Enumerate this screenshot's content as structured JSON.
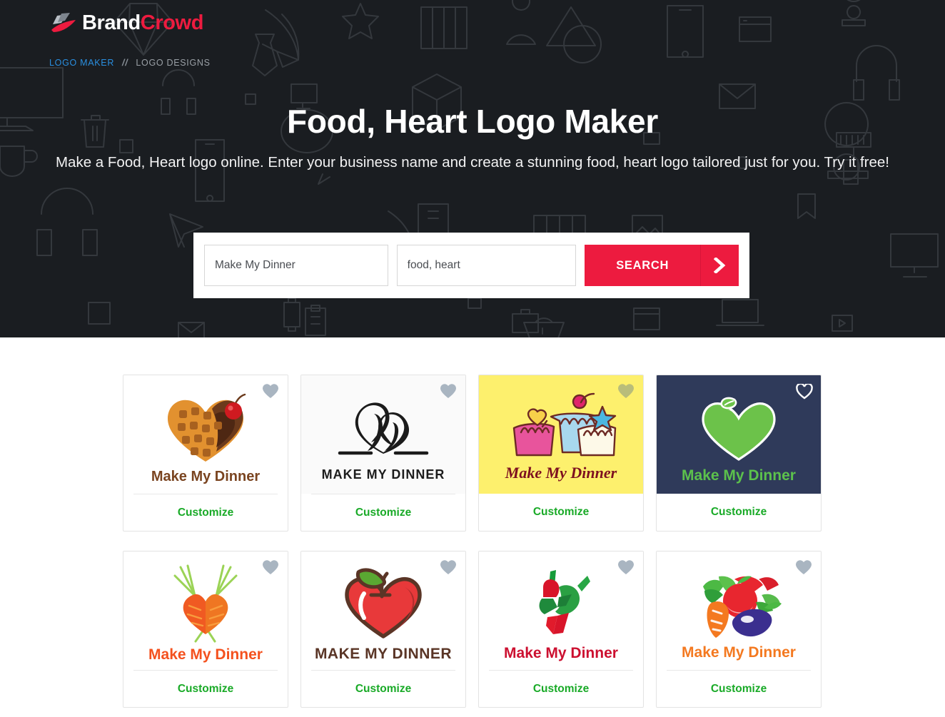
{
  "brand": {
    "name_part1": "Brand",
    "name_part2": "Crowd",
    "mark_icon": "swoosh-logo-icon"
  },
  "breadcrumb": {
    "home_label": "LOGO MAKER",
    "separator": "//",
    "current_label": "LOGO DESIGNS"
  },
  "hero": {
    "title": "Food, Heart Logo Maker",
    "subtitle": "Make a Food, Heart logo online. Enter your business name and create a stunning food, heart logo tailored just for you. Try it free!",
    "background_color": "#1a1d21",
    "background_pattern": "outline-doodle-icons"
  },
  "search": {
    "business_name_value": "Make My Dinner",
    "business_name_placeholder": "Make My Dinner",
    "keywords_value": "food, heart",
    "keywords_placeholder": "food, heart",
    "button_label": "SEARCH",
    "button_color": "#ED1B3F",
    "arrow_icon": "chevron-right-icon"
  },
  "results": {
    "customize_label": "Customize",
    "customize_color": "#19aa27",
    "favorite_icon": "heart-icon",
    "cards": [
      {
        "id": "waffle-heart",
        "logo_text": "Make My Dinner",
        "art_name": "heart-waffle-with-cherry-icon",
        "card_bg": "#ffffff",
        "text_color": "#7a4420",
        "text_size": "20px",
        "fav_style": "filled",
        "fav_color": "#a9b5c1"
      },
      {
        "id": "abstract-heart-swirl",
        "logo_text": "MAKE MY DINNER",
        "art_name": "abstract-heart-swirl-icon",
        "card_bg": "#fafafa",
        "text_color": "#1d1d1d",
        "text_size": "18px",
        "fav_style": "filled",
        "fav_color": "#a9b5c1"
      },
      {
        "id": "cupcakes-trio",
        "logo_text": "Make My Dinner",
        "art_name": "three-cupcakes-icon",
        "card_bg": "#fdf06d",
        "text_color": "#7d1020",
        "text_size": "22px",
        "fav_style": "filled",
        "fav_color": "#b9bd7a"
      },
      {
        "id": "green-apple-heart",
        "logo_text": "Make My Dinner",
        "art_name": "green-heart-apple-with-leaf-icon",
        "card_bg": "#2f3a5a",
        "text_color": "#5cc14c",
        "text_size": "21px",
        "fav_style": "outline",
        "fav_color": "#ffffff"
      },
      {
        "id": "carrot-heart",
        "logo_text": "Make My Dinner",
        "art_name": "two-carrots-heart-icon",
        "card_bg": "#ffffff",
        "text_color": "#f4511e",
        "text_size": "21px",
        "fav_style": "filled",
        "fav_color": "#a9b5c1"
      },
      {
        "id": "red-apple-heart",
        "logo_text": "MAKE MY DINNER",
        "art_name": "red-heart-apple-with-leaf-icon",
        "card_bg": "#ffffff",
        "text_color": "#5a3526",
        "text_size": "21px",
        "fav_style": "filled",
        "fav_color": "#a9b5c1"
      },
      {
        "id": "chili-heart",
        "logo_text": "Make My Dinner",
        "art_name": "abstract-chili-pepper-heart-icon",
        "card_bg": "#ffffff",
        "text_color": "#cc1030",
        "text_size": "21px",
        "fav_style": "filled",
        "fav_color": "#a9b5c1"
      },
      {
        "id": "vegetables-heart",
        "logo_text": "Make My Dinner",
        "art_name": "vegetables-heart-icon",
        "card_bg": "#ffffff",
        "text_color": "#f47920",
        "text_size": "21px",
        "fav_style": "filled",
        "fav_color": "#a9b5c1"
      }
    ]
  }
}
